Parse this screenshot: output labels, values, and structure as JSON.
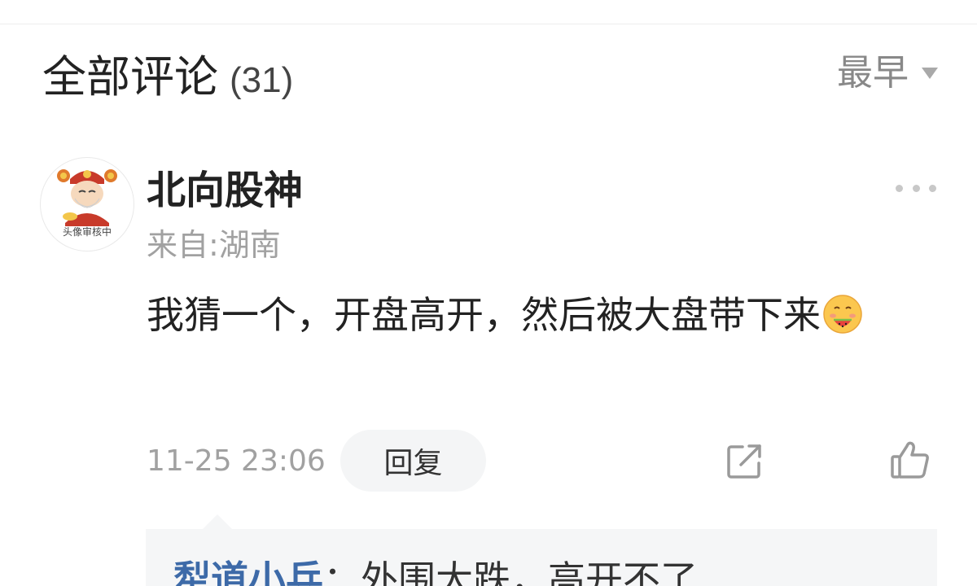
{
  "header": {
    "title": "全部评论",
    "count": "(31)",
    "sort_label": "最早"
  },
  "comment": {
    "author": "北向股神",
    "location": "来自:湖南",
    "avatar_badge": "头像审核中",
    "text": "我猜一个，开盘高开，然后被大盘带下来",
    "emoji": "watermelon-face-emoji",
    "timestamp": "11-25 23:06",
    "reply_label": "回复"
  },
  "replies": [
    {
      "author": "犁道小兵",
      "separator": "：",
      "text": "外围大跌，高开不了"
    }
  ],
  "colors": {
    "reply_author": "#3d6aa8",
    "muted_text": "#a1a1a1",
    "reply_bg": "#f5f6f7"
  },
  "icons": {
    "sort": "chevron-down-icon",
    "more": "more-dots-icon",
    "share": "share-icon",
    "like": "thumbs-up-icon"
  }
}
